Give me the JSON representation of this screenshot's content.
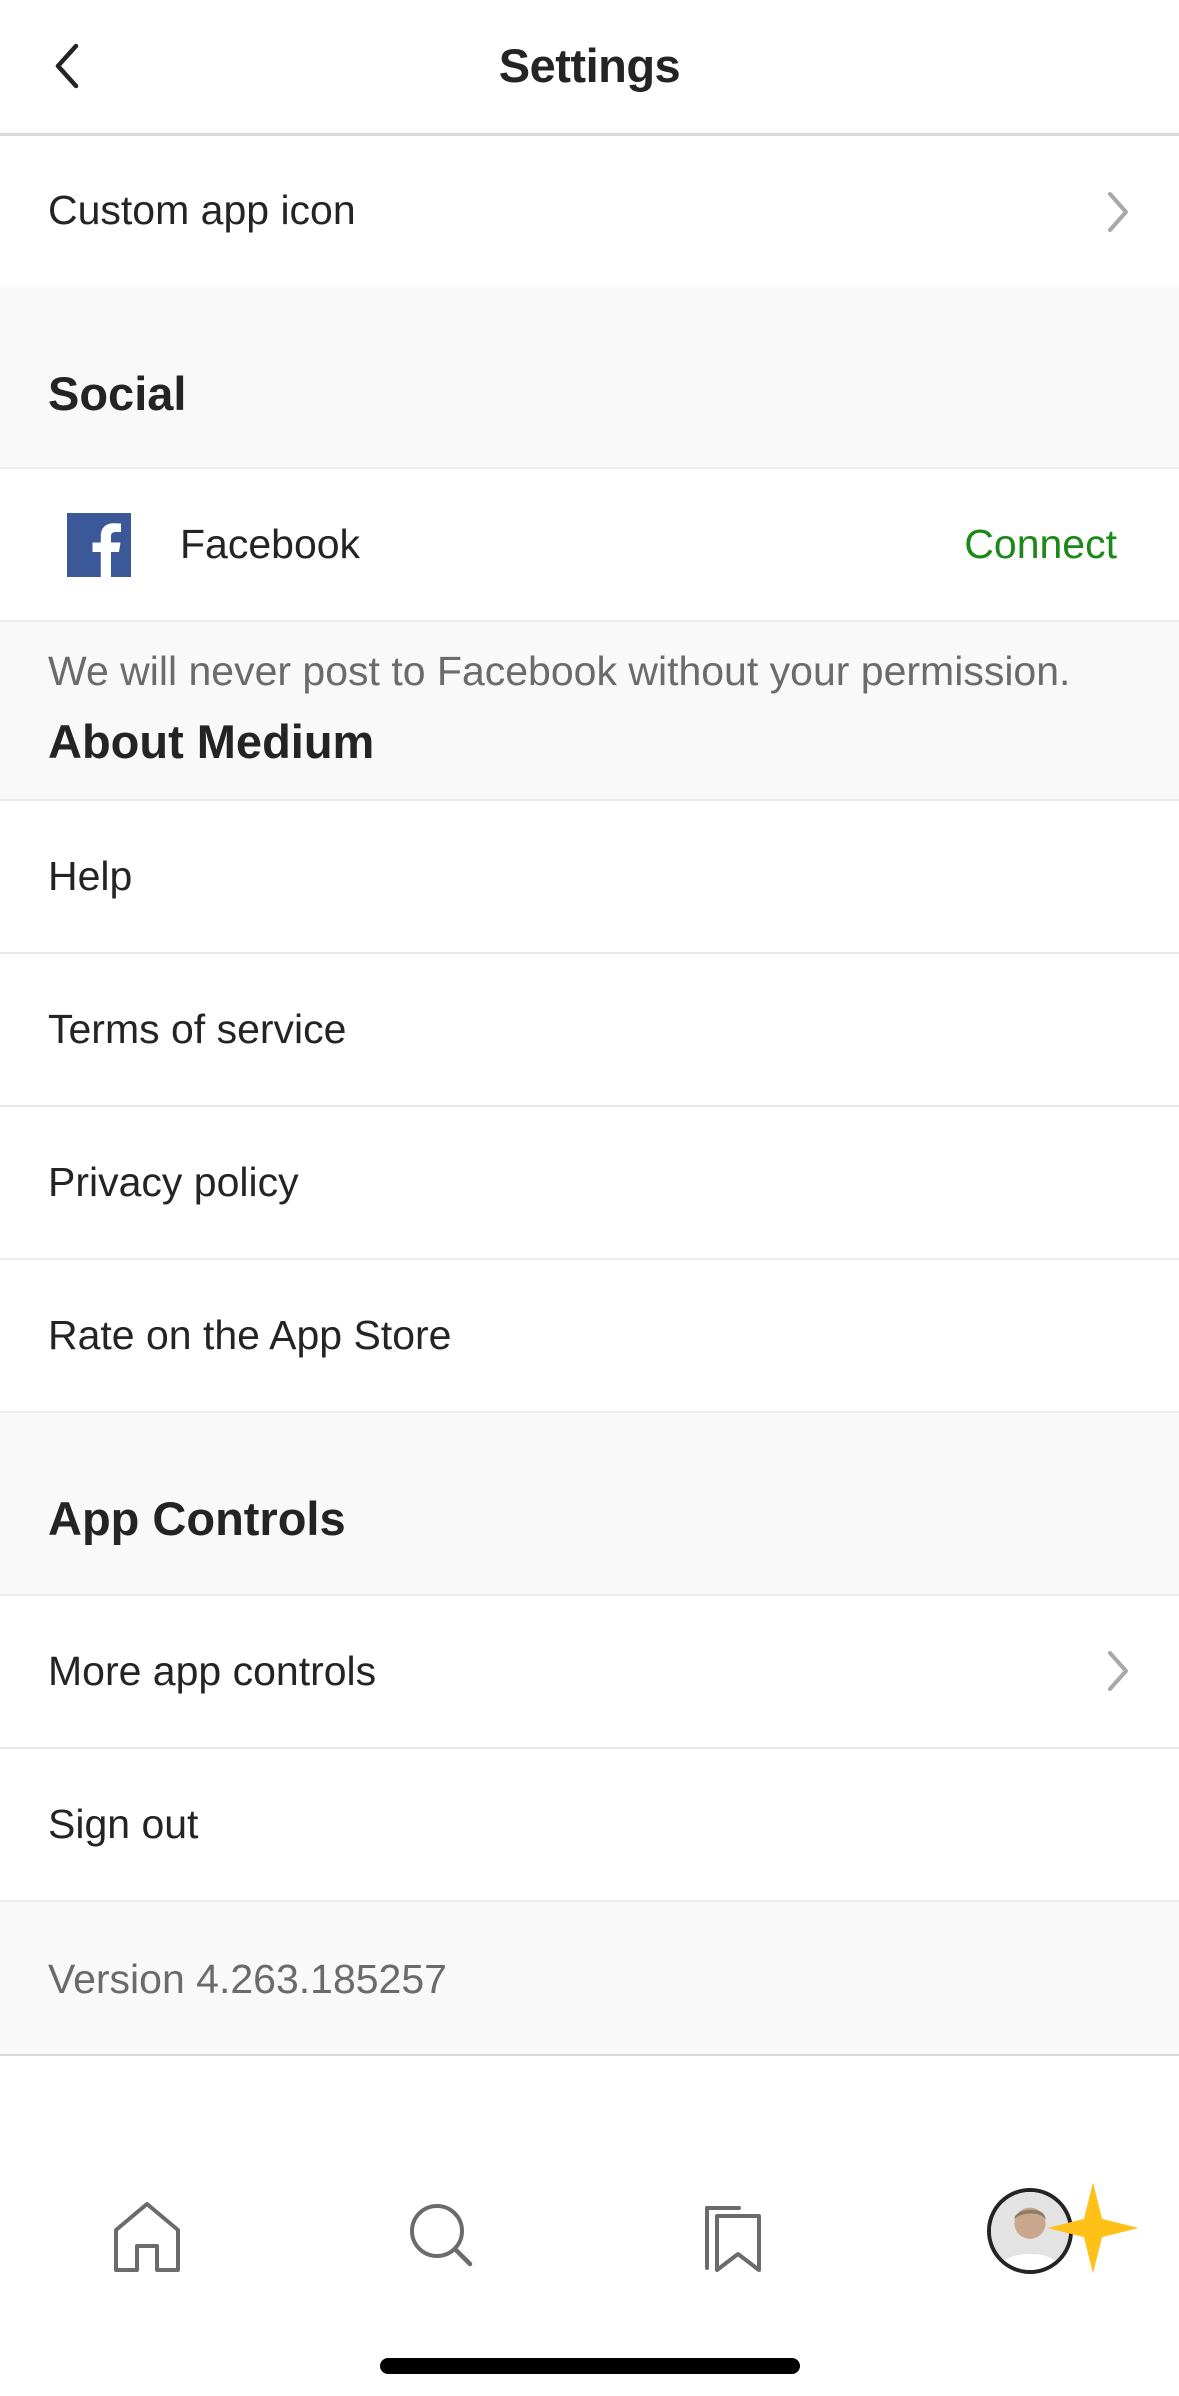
{
  "header": {
    "title": "Settings"
  },
  "rows": {
    "custom_app_icon": "Custom app icon"
  },
  "social": {
    "title": "Social",
    "facebook": {
      "label": "Facebook",
      "action": "Connect"
    },
    "note": "We will never post to Facebook without your permission."
  },
  "about": {
    "title": "About Medium",
    "items": [
      {
        "label": "Help"
      },
      {
        "label": "Terms of service"
      },
      {
        "label": "Privacy policy"
      },
      {
        "label": "Rate on the App Store"
      }
    ]
  },
  "app_controls": {
    "title": "App Controls",
    "more": "More app controls",
    "sign_out": "Sign out"
  },
  "version": "Version 4.263.185257",
  "tabbar": {
    "items": [
      "home-icon",
      "search-icon",
      "bookmarks-icon",
      "profile-avatar"
    ]
  },
  "colors": {
    "accent_green": "#1a8917",
    "facebook_blue": "#3b5998",
    "star_yellow": "#ffc017",
    "section_bg": "#f9f9f9"
  }
}
